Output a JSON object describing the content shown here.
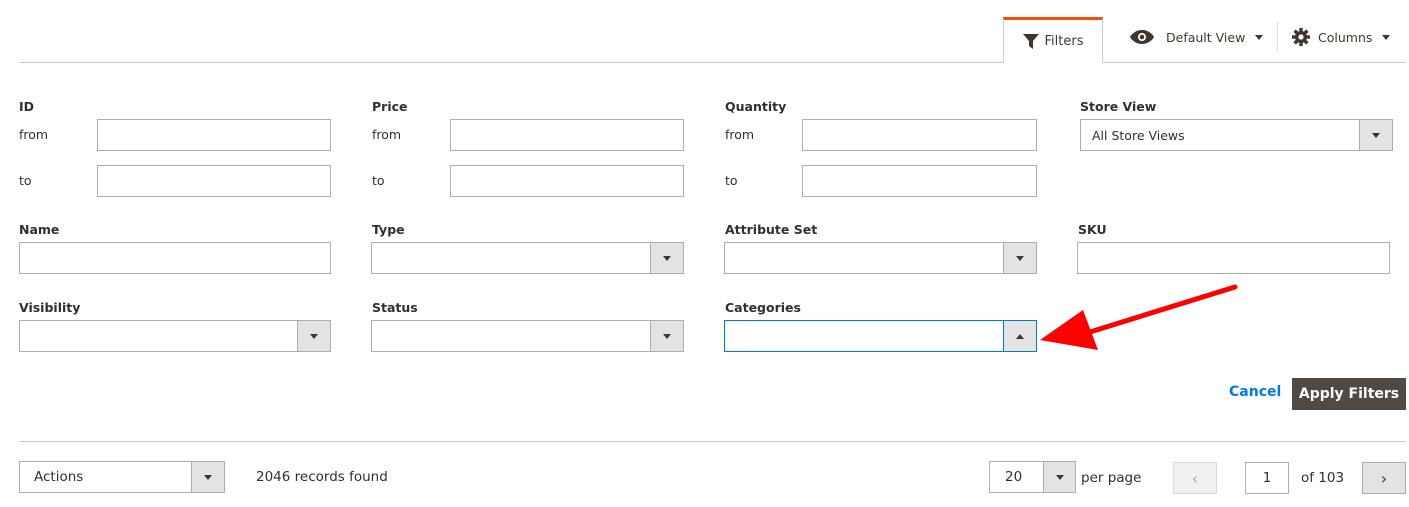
{
  "toolbar": {
    "filters_label": "Filters",
    "default_view_label": "Default View",
    "columns_label": "Columns",
    "accent_color": "#eb5202"
  },
  "filters": {
    "id": {
      "label": "ID",
      "from_label": "from",
      "to_label": "to",
      "from_value": "",
      "to_value": ""
    },
    "price": {
      "label": "Price",
      "from_label": "from",
      "to_label": "to",
      "from_value": "",
      "to_value": ""
    },
    "quantity": {
      "label": "Quantity",
      "from_label": "from",
      "to_label": "to",
      "from_value": "",
      "to_value": ""
    },
    "store_view": {
      "label": "Store View",
      "value": "All Store Views"
    },
    "name": {
      "label": "Name",
      "value": ""
    },
    "type": {
      "label": "Type",
      "value": ""
    },
    "attribute_set": {
      "label": "Attribute Set",
      "value": ""
    },
    "sku": {
      "label": "SKU",
      "value": ""
    },
    "visibility": {
      "label": "Visibility",
      "value": ""
    },
    "status": {
      "label": "Status",
      "value": ""
    },
    "categories": {
      "label": "Categories",
      "value": "",
      "expanded": true
    }
  },
  "buttons": {
    "cancel_label": "Cancel",
    "apply_label": "Apply Filters"
  },
  "footer": {
    "actions_label": "Actions",
    "records_found": "2046 records found",
    "per_page_value": "20",
    "per_page_label": "per page",
    "current_page": "1",
    "total_pages_label": "of 103"
  },
  "annotation": {
    "color": "#ff0000",
    "target": "categories-dropdown-button"
  }
}
